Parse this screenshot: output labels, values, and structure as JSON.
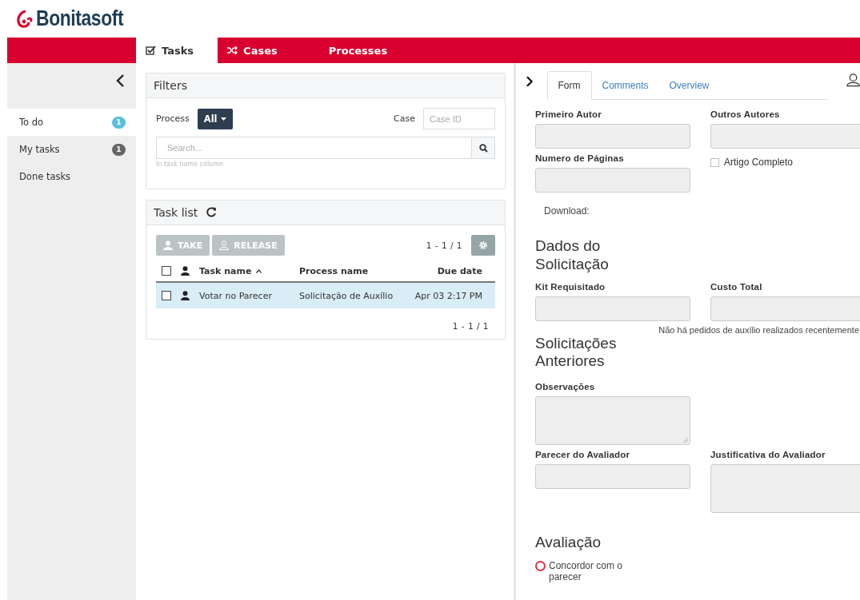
{
  "logo": "Bonitasoft",
  "nav_tabs": [
    {
      "label": "Tasks",
      "kind": "check",
      "selected": true
    },
    {
      "label": "Cases",
      "kind": "shuffle",
      "selected": false
    },
    {
      "label": "Processes",
      "kind": "plain",
      "selected": false
    }
  ],
  "sidebar": {
    "items": [
      {
        "label": "To do",
        "count": "1",
        "color": "#5bc0de",
        "selected": true
      },
      {
        "label": "My tasks",
        "count": "1",
        "color": "#666666",
        "selected": false
      },
      {
        "label": "Done tasks",
        "selected": false
      }
    ]
  },
  "filters": {
    "title": "Filters",
    "process_label": "Process",
    "process_button": "All",
    "case_label": "Case",
    "case_placeholder": "Case ID",
    "search_placeholder": "Search...",
    "search_hint": "In task name column"
  },
  "task_list": {
    "title": "Task list",
    "actions": [
      {
        "label": "TAKE",
        "kind": "take",
        "disabled": true
      },
      {
        "label": "RELEASE",
        "kind": "release",
        "disabled": true
      }
    ],
    "all_checked": false,
    "pagination": "1 - 1 / 1",
    "columns": [
      {
        "label": "Task name",
        "sorted": true
      },
      {
        "label": "Process name",
        "sorted": false
      },
      {
        "label": "Due date",
        "sorted": false
      }
    ],
    "rows": [
      {
        "task": "Votar no Parecer",
        "process": "Solicitação de Auxílio",
        "due": "Apr 03 2:17 PM",
        "selected": true,
        "checked": false
      }
    ],
    "footer_pagination": "1 - 1 / 1"
  },
  "details": {
    "tabs": [
      {
        "label": "Form",
        "selected": true
      },
      {
        "label": "Comments",
        "selected": false
      },
      {
        "label": "Overview",
        "selected": false
      }
    ],
    "form": [
      {
        "kind": "fields",
        "fields": [
          {
            "kind": "input",
            "label": "Primeiro Autor"
          },
          {
            "kind": "input",
            "label": "Outros Autores"
          }
        ]
      },
      {
        "kind": "fields",
        "fields": [
          {
            "kind": "input",
            "label": "Numero de Páginas"
          },
          {
            "kind": "checkbox",
            "label": "Artigo Completo",
            "checked": false
          }
        ]
      },
      {
        "kind": "text",
        "text": "Download:"
      },
      {
        "kind": "heading",
        "text": "Dados do Solicitação"
      },
      {
        "kind": "fields",
        "fields": [
          {
            "kind": "input",
            "label": "Kit Requisitado"
          },
          {
            "kind": "input",
            "label": "Custo Total"
          }
        ]
      },
      {
        "kind": "note",
        "text": "Não há pedidos de auxílio realizados recentemente"
      },
      {
        "kind": "heading",
        "text": "Solicitações Anteriores"
      },
      {
        "kind": "fields",
        "fields": [
          {
            "kind": "textarea",
            "label": "Observações"
          }
        ]
      },
      {
        "kind": "fields",
        "fields": [
          {
            "kind": "input",
            "label": "Parecer do Avaliador"
          },
          {
            "kind": "textarea",
            "label": "Justificativa do Avaliador"
          }
        ]
      },
      {
        "kind": "heading",
        "text": "Avaliação"
      },
      {
        "kind": "radio",
        "label": "Concordor com o parecer",
        "checked": false
      }
    ]
  }
}
